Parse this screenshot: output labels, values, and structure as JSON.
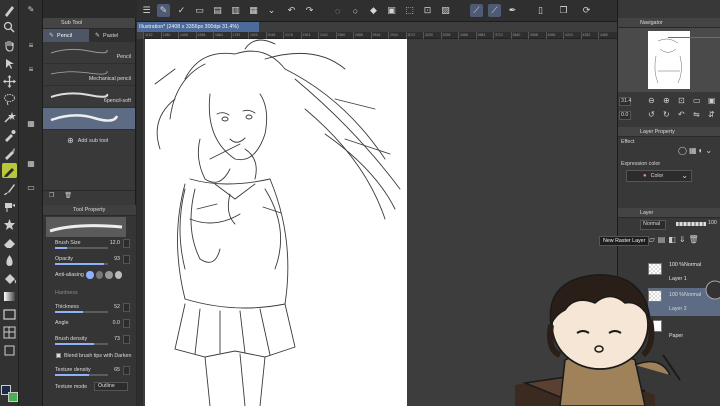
{
  "sub_tool": {
    "panel_title": "Sub Tool",
    "tabs": [
      {
        "label": "Pencil",
        "active": true
      },
      {
        "label": "Pastel",
        "active": false
      }
    ],
    "brushes": [
      {
        "name": "Pencil"
      },
      {
        "name": "Mechanical pencil"
      },
      {
        "name": "6pencil-soft",
        "selected": true
      }
    ],
    "add_label": "Add sub tool"
  },
  "tool_property": {
    "title": "Tool Property",
    "brush_size": {
      "label": "Brush Size",
      "value": "12.0"
    },
    "opacity": {
      "label": "Opacity",
      "value": "93"
    },
    "anti_aliasing": {
      "label": "Anti-aliasing"
    },
    "hardness": {
      "label": "Hardness"
    },
    "thickness": {
      "label": "Thickness",
      "value": "52"
    },
    "angle": {
      "label": "Angle",
      "value": "0.0"
    },
    "brush_density": {
      "label": "Brush density",
      "value": "73"
    },
    "blend_label": "Blend brush tips with Darken",
    "texture_density": {
      "label": "Texture density",
      "value": "65"
    },
    "texture_mode": {
      "label": "Texture mode",
      "value": "Outline"
    }
  },
  "document": {
    "tab_title": "Illustration* (2408 x 3356px 300dpi 31.4%)",
    "ruler_ticks": [
      "1152",
      "1280",
      "1408",
      "1536",
      "1664",
      "1792",
      "1920",
      "2048",
      "2176",
      "2304",
      "2432",
      "2560",
      "2688",
      "2816",
      "2944",
      "3072",
      "3200",
      "3328",
      "3456",
      "3584",
      "3712",
      "3840",
      "3968",
      "4096",
      "4224",
      "4352",
      "4480"
    ]
  },
  "navigator": {
    "title": "Navigator",
    "zoom": "31.4",
    "angle": "0.0"
  },
  "layer_property": {
    "title": "Layer Property",
    "effect_label": "Effect",
    "expression_color_label": "Expression color",
    "expression_color_value": "Color"
  },
  "layers": {
    "title": "Layer",
    "blend_mode": "Normal",
    "opacity": "100",
    "tooltip": "New Raster Layer",
    "items": [
      {
        "blend": "100 %Normal",
        "name": "Layer 1",
        "selected": false
      },
      {
        "blend": "100 %Normal",
        "name": "Layer 2",
        "selected": true
      },
      {
        "blend": "",
        "name": "Paper",
        "selected": false
      }
    ]
  },
  "colors": {
    "accent": "#b8c83a",
    "selection": "#4c6a9a",
    "main_color": "#1a2a4a",
    "sub_color": "#4caf50"
  }
}
